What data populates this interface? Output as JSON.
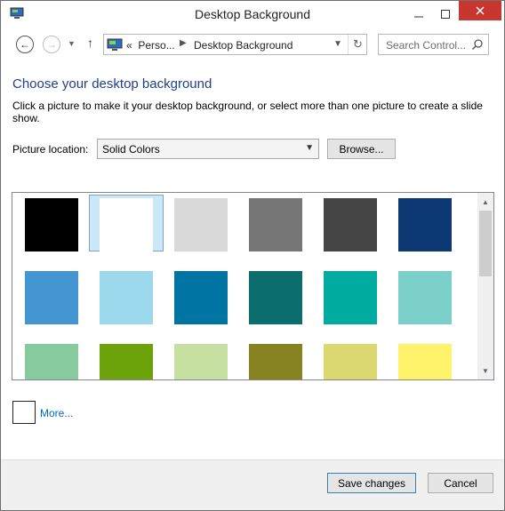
{
  "window": {
    "title": "Desktop Background"
  },
  "address": {
    "prefix": "«",
    "crumb1": "Perso...",
    "crumb2": "Desktop Background",
    "search_placeholder": "Search Control..."
  },
  "main": {
    "heading": "Choose your desktop background",
    "description": "Click a picture to make it your desktop background, or select more than one picture to create a slide show.",
    "location_label": "Picture location:",
    "location_value": "Solid Colors",
    "browse_label": "Browse..."
  },
  "swatches": [
    {
      "color": "#000000",
      "selected": false
    },
    {
      "color": "#ffffff",
      "selected": true
    },
    {
      "color": "#d9d9d9",
      "selected": false
    },
    {
      "color": "#767676",
      "selected": false
    },
    {
      "color": "#454545",
      "selected": false
    },
    {
      "color": "#0c3873",
      "selected": false
    },
    {
      "color": "#4496d3",
      "selected": false
    },
    {
      "color": "#9dd9ed",
      "selected": false
    },
    {
      "color": "#0074a2",
      "selected": false
    },
    {
      "color": "#0b6d6c",
      "selected": false
    },
    {
      "color": "#00aca0",
      "selected": false
    },
    {
      "color": "#7bcfc9",
      "selected": false
    },
    {
      "color": "#86ca9d",
      "selected": false
    },
    {
      "color": "#6ca30b",
      "selected": false
    },
    {
      "color": "#c5e0a0",
      "selected": false
    },
    {
      "color": "#868320",
      "selected": false
    },
    {
      "color": "#dcd870",
      "selected": false
    },
    {
      "color": "#fff36c",
      "selected": false
    }
  ],
  "more_label": "More...",
  "footer": {
    "save_label": "Save changes",
    "cancel_label": "Cancel"
  }
}
